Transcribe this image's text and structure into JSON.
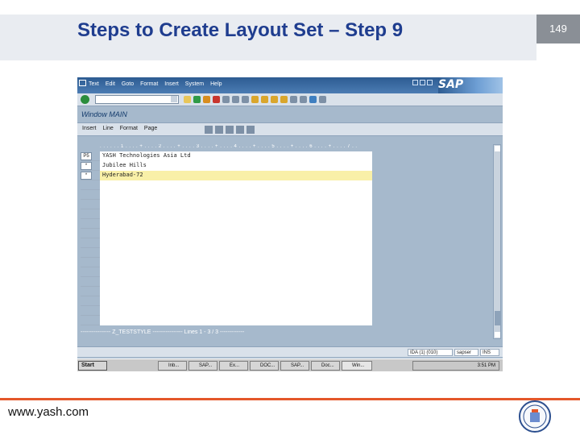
{
  "slide": {
    "title": "Steps to Create Layout Set – Step 9",
    "page_number": "149",
    "footer_url": "www.yash.com"
  },
  "sap": {
    "menu": [
      "Text",
      "Edit",
      "Goto",
      "Format",
      "Insert",
      "System",
      "Help"
    ],
    "logo": "SAP",
    "window_title": "Window MAIN",
    "app_toolbar": [
      "Insert",
      "Line",
      "Format",
      "Page"
    ],
    "ruler": ". . . . . . 1 . . . . + . . . . 2 . . . . + . . . . 3 . . . . + . . . . 4 . . . . + . . . . 5 . . . . + . . . . 6 . . . . + . . . . 7 . .",
    "rows": [
      {
        "flag": "P5",
        "text": "YASH Technologies Asia Ltd"
      },
      {
        "flag": "*",
        "text": "Jubilee Hills"
      },
      {
        "flag": "*",
        "text": "Hyderabad-72"
      }
    ],
    "separator": "---------------- Z_TESTSTYLE ---------------- Lines 1 - 3 / 3 -------------",
    "status": {
      "system": "IDA (1) (010)",
      "server": "sapser",
      "mode": "INS"
    },
    "taskbar": {
      "start": "Start",
      "tasks": [
        "Inb...",
        "SAP...",
        "Ex...",
        "DOC...",
        "SAP...",
        "Doc...",
        "Win..."
      ],
      "clock": "3:51 PM"
    }
  },
  "colors": {
    "title": "#1f3d8f",
    "accent_line": "#e4572a",
    "sap_blue": "#2d5c92",
    "active_row": "#f9f0a8"
  }
}
